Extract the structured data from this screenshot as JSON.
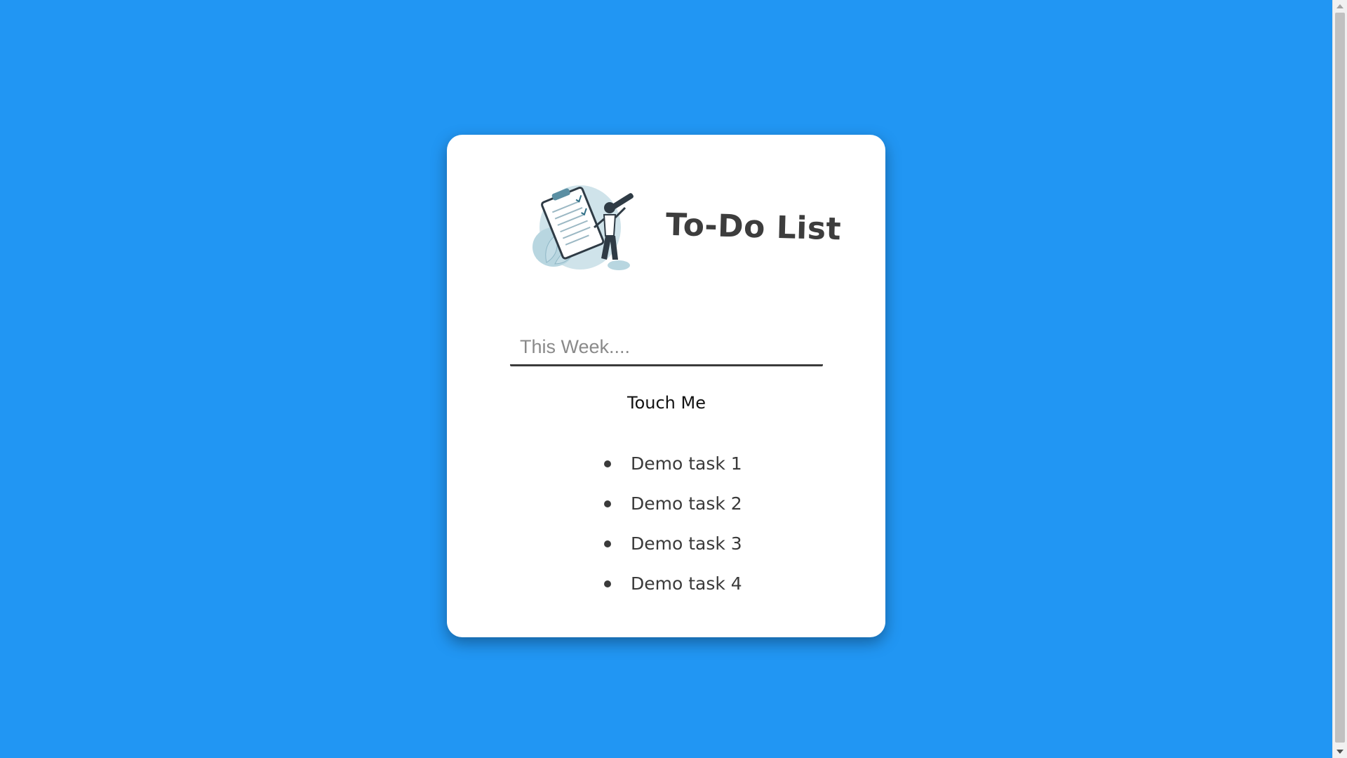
{
  "app": {
    "title": "To-Do List",
    "background_color": "#2196f3",
    "card_color": "#ffffff",
    "illustration_icon": "todo-clipboard-illustration"
  },
  "input": {
    "placeholder": "This Week....",
    "value": ""
  },
  "add_button": {
    "label": "Touch Me"
  },
  "tasks": [
    {
      "label": "Demo task 1"
    },
    {
      "label": "Demo task 2"
    },
    {
      "label": "Demo task 3"
    },
    {
      "label": "Demo task 4"
    }
  ]
}
